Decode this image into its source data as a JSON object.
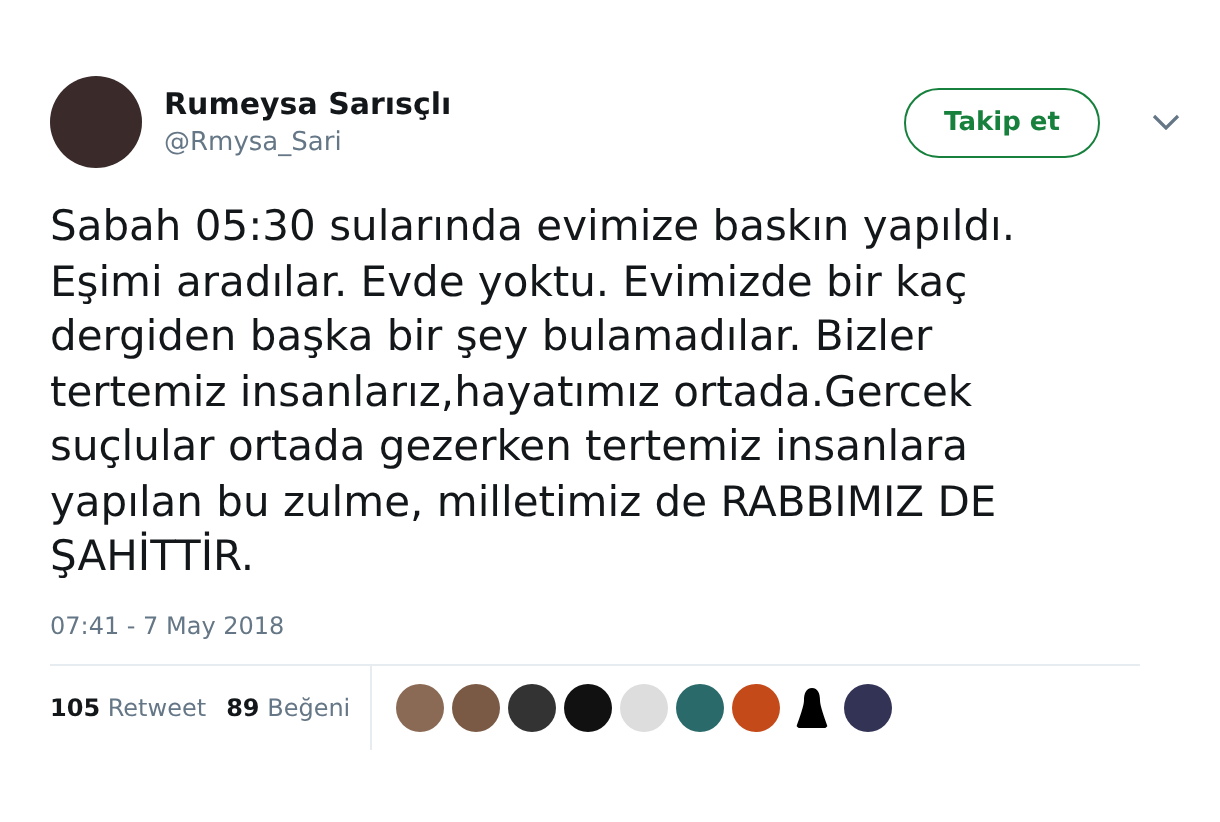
{
  "tweet": {
    "author_name": "Rumeysa Sarısçlı",
    "author_handle": "@Rmysa_Sari",
    "follow_button": "Takip et",
    "text": "Sabah 05:30 sularında evimize baskın yapıldı.\nEşimi aradılar. Evde yoktu. Evimizde bir kaç\ndergiden başka bir şey bulamadılar. Bizler\ntertemiz insanlarız,hayatımız ortada.Gercek\nsuçlular ortada gezerken tertemiz insanlara\nyapılan bu zulme, milletimiz de RABBIMIZ DE\nŞAHİTTİR.",
    "timestamp": "07:41 - 7 May 2018",
    "stats": [
      {
        "count": "105",
        "label": "Retweet"
      },
      {
        "count": "89",
        "label": "Beğeni"
      }
    ]
  }
}
